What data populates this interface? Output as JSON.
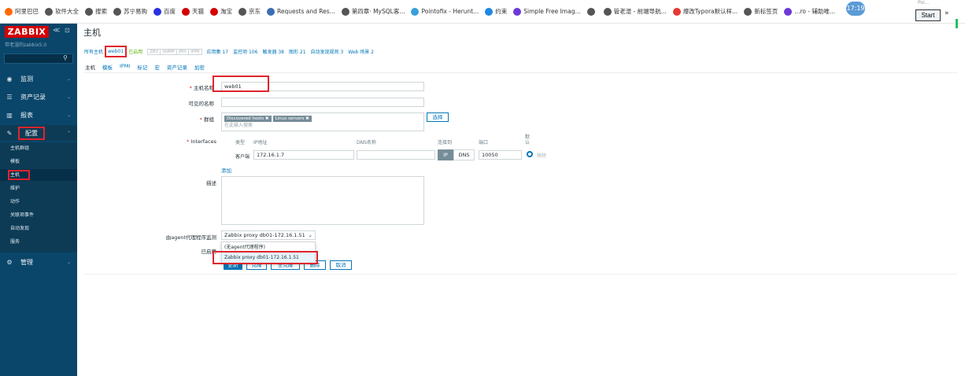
{
  "bookmarks": [
    {
      "icon": "alibaba-icon",
      "label": "阿里巴巴",
      "color": "#ff6a00"
    },
    {
      "icon": "globe-icon",
      "label": "软件大全",
      "color": "#555555"
    },
    {
      "icon": "globe-icon",
      "label": "搜索",
      "color": "#555555"
    },
    {
      "icon": "globe-icon",
      "label": "苏宁易购",
      "color": "#555555"
    },
    {
      "icon": "baidu-icon",
      "label": "百度",
      "color": "#2932e1"
    },
    {
      "icon": "tmall-icon",
      "label": "天猫",
      "color": "#d40000"
    },
    {
      "icon": "taobao-icon",
      "label": "淘宝",
      "color": "#d40000"
    },
    {
      "icon": "globe-icon",
      "label": "京东",
      "color": "#555555"
    },
    {
      "icon": "doc-icon",
      "label": "Requests and Res...",
      "color": "#3a6fb0"
    },
    {
      "icon": "globe-icon",
      "label": "第四章· MySQL客...",
      "color": "#555555"
    },
    {
      "icon": "pointofix-icon",
      "label": "Pointofix - Herunt...",
      "color": "#3aa0d8"
    },
    {
      "icon": "clock-icon",
      "label": "约束",
      "color": "#1e88e5"
    },
    {
      "icon": "simple-icon",
      "label": "Simple Free Imag...",
      "color": "#6c3ad8"
    },
    {
      "icon": "globe-icon",
      "label": "",
      "color": "#555555"
    },
    {
      "icon": "globe-icon",
      "label": "管老湿 - 前端导航...",
      "color": "#555555"
    },
    {
      "icon": "typora-icon",
      "label": "爆改Typora默认样...",
      "color": "#e53935"
    },
    {
      "icon": "globe-icon",
      "label": "新标签页",
      "color": "#555555"
    },
    {
      "icon": "notion-icon",
      "label": "...ro - 辅助唯...",
      "color": "#6c3ad8"
    }
  ],
  "overlay": {
    "clock": "17:19",
    "start": "Start",
    "poi": "Poi..."
  },
  "sidebar": {
    "logo": "ZABBIX",
    "server": "带老湿的zabbix5.0",
    "menu": [
      {
        "icon": "eye-icon",
        "label": "监测"
      },
      {
        "icon": "list-icon",
        "label": "资产记录"
      },
      {
        "icon": "chart-icon",
        "label": "报表"
      },
      {
        "icon": "wrench-icon",
        "label": "配置"
      },
      {
        "icon": "gear-icon",
        "label": "管理"
      }
    ],
    "submenu": [
      "主机群组",
      "模板",
      "主机",
      "维护",
      "动作",
      "关联项事件",
      "自动发现",
      "服务"
    ]
  },
  "page": {
    "title": "主机",
    "crumbs": {
      "all_hosts": "所有主机",
      "host": "web01",
      "enabled": "已启用",
      "zbx": "ZBX",
      "snmp": "SNMP",
      "jmx": "JMX",
      "ipmi": "IPMI",
      "apps": "应用集 17",
      "items": "监控项 106",
      "triggers": "触发器 38",
      "graphs": "图形 21",
      "discovery": "自动发现规则 3",
      "web": "Web 场景 2"
    },
    "tabs": [
      "主机",
      "模板",
      "IPMI",
      "标记",
      "宏",
      "资产记录",
      "加密"
    ]
  },
  "form": {
    "hostname_label": "主机名称",
    "hostname": "web01",
    "visible_label": "可见的名称",
    "visible": "",
    "groups_label": "群组",
    "groups": [
      "Discovered hosts",
      "Linux servers"
    ],
    "groups_placeholder": "在此输入搜索",
    "select_btn": "选择",
    "interfaces_label": "Interfaces",
    "if_headers": {
      "type": "类型",
      "ip": "IP地址",
      "dns": "DNS名称",
      "connect": "连接到",
      "port": "端口",
      "default": "默认"
    },
    "if_row": {
      "type": "客户端",
      "ip": "172.16.1.7",
      "dns": "",
      "ip_btn": "IP",
      "dns_btn": "DNS",
      "port": "10050",
      "remove": "移除"
    },
    "add": "添加",
    "desc_label": "描述",
    "proxy_label": "由agent代理程序监测",
    "proxy_value": "Zabbix proxy db01-172.16.1.51",
    "proxy_options": [
      "(无agent代理程序)",
      "Zabbix proxy db01-172.16.1.51"
    ],
    "enabled_label": "已启用",
    "buttons": {
      "update": "更新",
      "clone": "克隆",
      "full_clone": "全克隆",
      "delete": "删除",
      "cancel": "取消"
    }
  },
  "colors": {
    "sidebar": "#0a466a",
    "accent": "#0275b8",
    "highlight": "#e0252c"
  }
}
